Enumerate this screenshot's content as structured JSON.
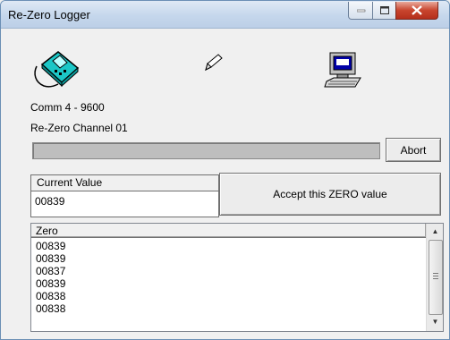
{
  "window": {
    "title": "Re-Zero Logger",
    "close_color": "#c8452e"
  },
  "icons": {
    "device": "logger-device-icon",
    "pencil": "pencil-icon",
    "computer": "computer-icon"
  },
  "status": {
    "comm": "Comm 4 - 9600",
    "channel": "Re-Zero Channel 01"
  },
  "progress": {
    "value_percent": 0
  },
  "buttons": {
    "abort": "Abort",
    "accept": "Accept this ZERO value"
  },
  "current_value": {
    "label": "Current Value",
    "value": "00839"
  },
  "zero_list": {
    "header": "Zero",
    "rows": [
      "00839",
      "00839",
      "00837",
      "00839",
      "00838",
      "00838"
    ]
  }
}
